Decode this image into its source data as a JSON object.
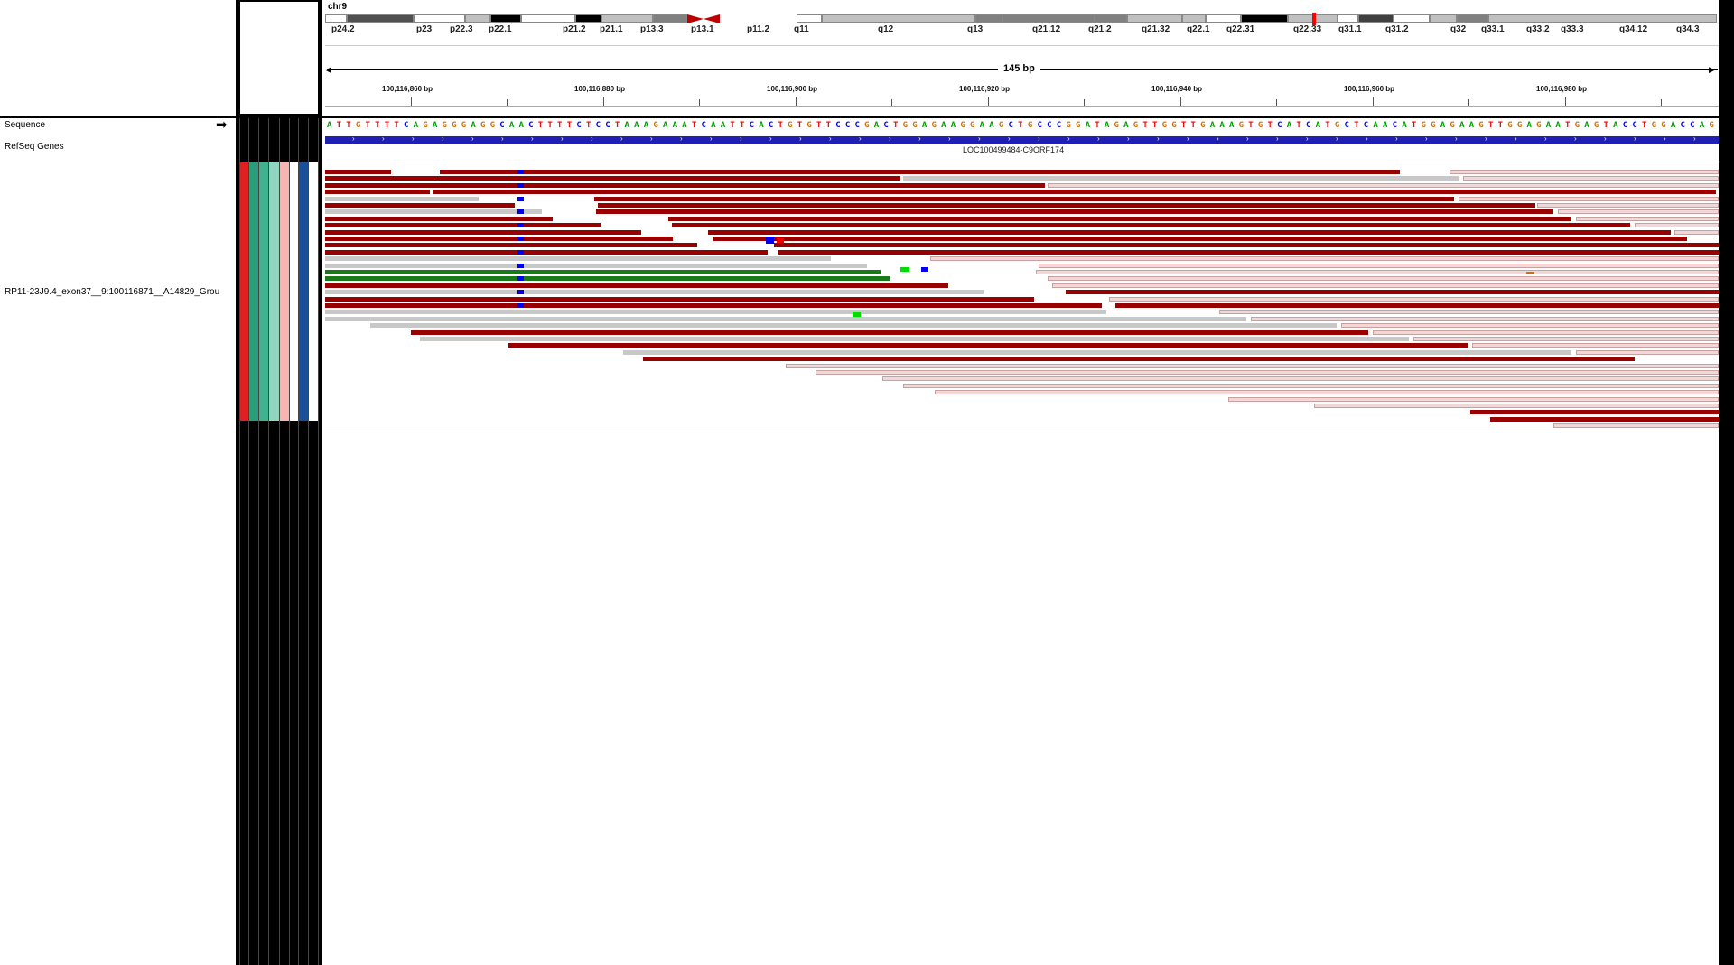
{
  "chromosome": {
    "name": "chr9",
    "bands": [
      {
        "label": "p24.2",
        "color": "#ffffff"
      },
      {
        "label": "p23",
        "color": "#505050"
      },
      {
        "label": "p22.3",
        "color": "#ffffff"
      },
      {
        "label": "p22.1",
        "color": "#c0c0c0"
      },
      {
        "label": "p21.2",
        "color": "#000000"
      },
      {
        "label": "p21.1",
        "color": "#ffffff"
      },
      {
        "label": "p13.3",
        "color": "#000000"
      },
      {
        "label": "p13.1",
        "color": "#c0c0c0"
      },
      {
        "label": "p11.2",
        "color": "#808080"
      },
      {
        "label": "q11",
        "color": "#c00000"
      },
      {
        "label": "q12",
        "color": "#ffffff"
      },
      {
        "label": "q13",
        "color": "#c0c0c0"
      },
      {
        "label": "q21.12",
        "color": "#808080"
      },
      {
        "label": "q21.2",
        "color": "#808080"
      },
      {
        "label": "q21.32",
        "color": "#808080"
      },
      {
        "label": "q22.1",
        "color": "#c0c0c0"
      },
      {
        "label": "q22.31",
        "color": "#c0c0c0"
      },
      {
        "label": "q22.33",
        "color": "#ffffff"
      },
      {
        "label": "q31.1",
        "color": "#000000"
      },
      {
        "label": "q31.2",
        "color": "#c0c0c0"
      },
      {
        "label": "q32",
        "color": "#ffffff"
      },
      {
        "label": "q33.1",
        "color": "#404040"
      },
      {
        "label": "q33.2",
        "color": "#ffffff"
      },
      {
        "label": "q33.3",
        "color": "#c0c0c0"
      },
      {
        "label": "q34.12",
        "color": "#808080"
      },
      {
        "label": "q34.3",
        "color": "#c0c0c0"
      }
    ]
  },
  "ruler": {
    "span_label": "145 bp",
    "positions": [
      "100,116,860 bp",
      "100,116,880 bp",
      "100,116,900 bp",
      "100,116,920 bp",
      "100,116,940 bp",
      "100,116,960 bp",
      "100,116,980 bp"
    ]
  },
  "tracks": {
    "sequence_label": "Sequence",
    "sequence_arrow": "➡",
    "genes_label": "RefSeq Genes",
    "gene_name": "LOC100499484-C9ORF174",
    "alignment_label": "RP11-23J9.4_exon37__9:100116871__A14829_Grou"
  },
  "sequence": "ATTGTTTTCAGAGGGAGGCAACTTTTCTCCTAAAGAAATCAATTCACTGTGTTCCCGACTGGAGAAGGAAGCTGCCCGGATAGAGTTGGTTGAAAGTGTCATCATGCTCAACATGGAGAAGTTGGAGAATGAGTACCTGGACCAG",
  "base_colors": {
    "A": "#00a000",
    "C": "#0000ff",
    "G": "#d17105",
    "T": "#ff0000"
  },
  "attribute_colors": [
    "#e02020",
    "#2a9d7a",
    "#3fb28f",
    "#8fd5c0",
    "#f5b5b0",
    "#ffffff",
    "#1a4f9c",
    "#ffffff"
  ],
  "read_colors": {
    "forward_dark": "#990000",
    "reverse_light": "#c8c8c8",
    "pale": "#f0d8d8"
  }
}
